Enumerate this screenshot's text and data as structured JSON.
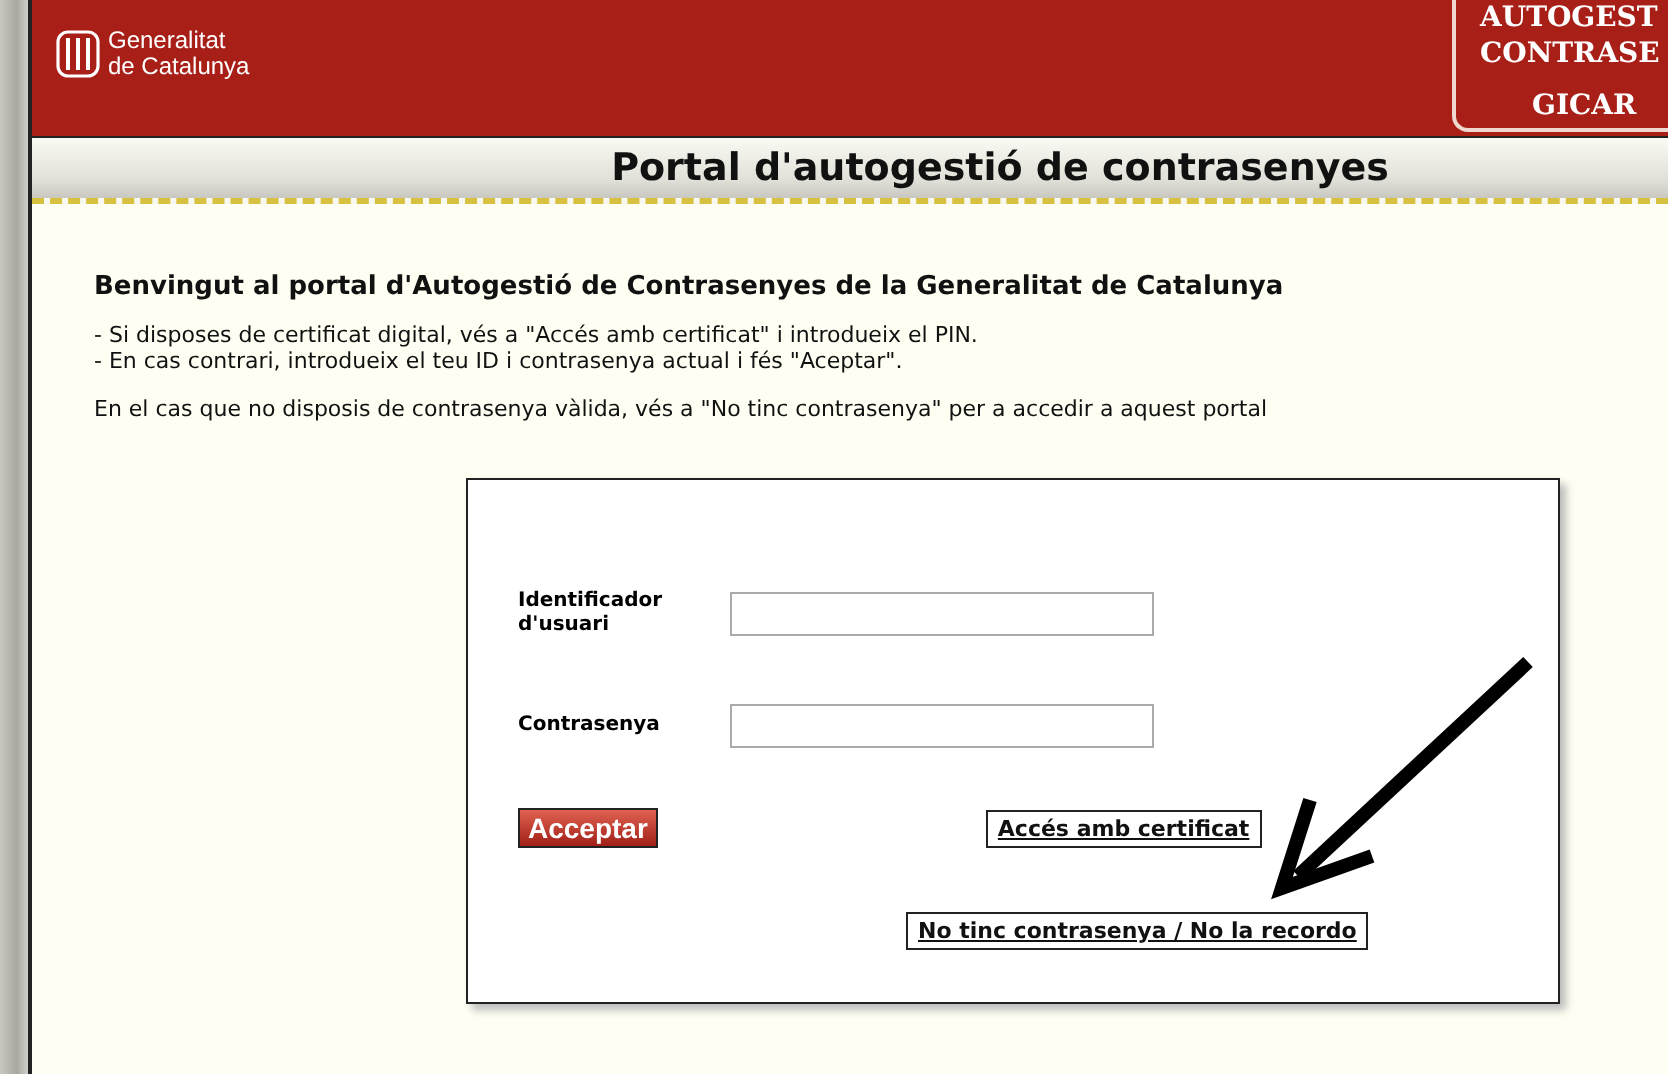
{
  "header": {
    "logo_lines": [
      "Generalitat",
      "de Catalunya"
    ],
    "badge_lines": [
      "AUTOGEST",
      "CONTRASE",
      "GICAR"
    ]
  },
  "title_bar": {
    "title": "Portal d'autogestió de contrasenyes"
  },
  "intro": {
    "heading": "Benvingut al portal d'Autogestió de Contrasenyes de la Generalitat de Catalunya",
    "lines": [
      "- Si disposes de certificat digital, vés a \"Accés amb certificat\" i introdueix el PIN.",
      "- En cas contrari, introdueix el teu ID i contrasenya actual i fés \"Aceptar\"."
    ],
    "note": "En el cas que no disposis de contrasenya vàlida, vés a \"No tinc contrasenya\" per a accedir a aquest portal"
  },
  "form": {
    "fields": [
      {
        "label": "Identificador d'usuari"
      },
      {
        "label": "Contrasenya"
      }
    ],
    "submit": "Acceptar",
    "certificate_link": "Accés amb certificat",
    "forgot_link": "No tinc contrasenya / No la recordo"
  }
}
